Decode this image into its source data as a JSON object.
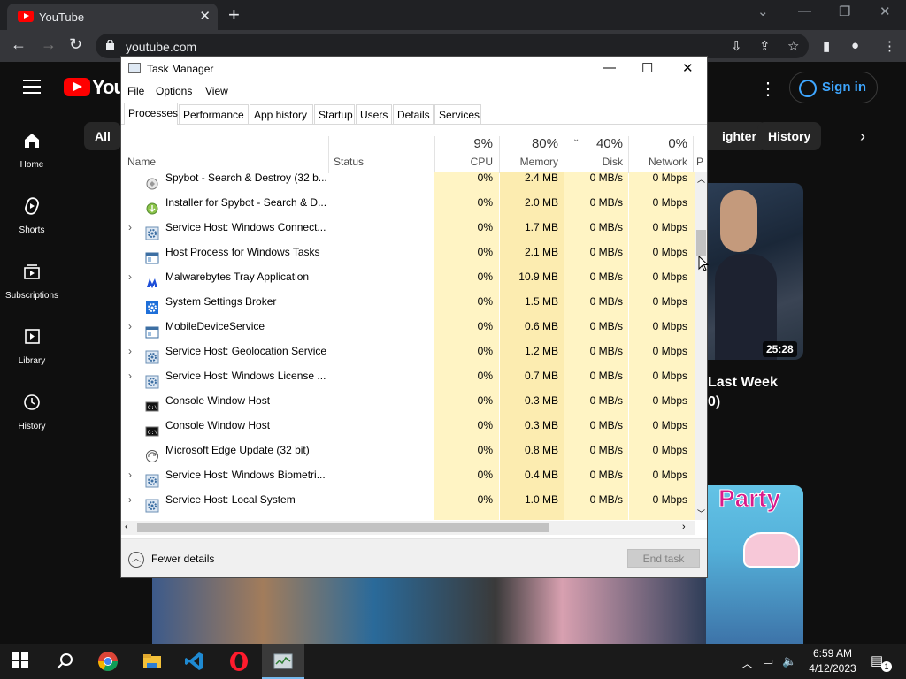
{
  "browser": {
    "tab_title": "YouTube",
    "url": "youtube.com"
  },
  "youtube": {
    "logo_text": "YouT",
    "sidebar": [
      {
        "label": "Home",
        "icon": "home-icon"
      },
      {
        "label": "Shorts",
        "icon": "shorts-icon"
      },
      {
        "label": "Subscriptions",
        "icon": "subscriptions-icon"
      },
      {
        "label": "Library",
        "icon": "library-icon"
      },
      {
        "label": "History",
        "icon": "history-icon"
      }
    ],
    "chips": [
      "All",
      "ighter",
      "History"
    ],
    "sign_in": "Sign in",
    "video1_duration": "25:28",
    "video1_title_line1": "Last Week",
    "video1_title_line2": "0)",
    "video2_overlay": "Party"
  },
  "task_manager": {
    "title": "Task Manager",
    "menu": [
      "File",
      "Options",
      "View"
    ],
    "tabs": [
      "Processes",
      "Performance",
      "App history",
      "Startup",
      "Users",
      "Details",
      "Services"
    ],
    "active_tab": "Processes",
    "columns": {
      "name": "Name",
      "status": "Status",
      "cpu": {
        "pct": "9%",
        "label": "CPU"
      },
      "memory": {
        "pct": "80%",
        "label": "Memory"
      },
      "disk": {
        "pct": "40%",
        "label": "Disk"
      },
      "network": {
        "pct": "0%",
        "label": "Network"
      },
      "power": "P"
    },
    "rows": [
      {
        "name": "Spybot - Search & Destroy (32 b...",
        "expand": false,
        "icon": "spybot-icon",
        "cpu": "0%",
        "memory": "2.4 MB",
        "disk": "0 MB/s",
        "network": "0 Mbps"
      },
      {
        "name": "Installer for Spybot - Search & D...",
        "expand": false,
        "icon": "installer-icon",
        "cpu": "0%",
        "memory": "2.0 MB",
        "disk": "0 MB/s",
        "network": "0 Mbps"
      },
      {
        "name": "Service Host: Windows Connect...",
        "expand": true,
        "icon": "gear-icon",
        "cpu": "0%",
        "memory": "1.7 MB",
        "disk": "0 MB/s",
        "network": "0 Mbps"
      },
      {
        "name": "Host Process for Windows Tasks",
        "expand": false,
        "icon": "window-icon",
        "cpu": "0%",
        "memory": "2.1 MB",
        "disk": "0 MB/s",
        "network": "0 Mbps"
      },
      {
        "name": "Malwarebytes Tray Application",
        "expand": true,
        "icon": "malwarebytes-icon",
        "cpu": "0%",
        "memory": "10.9 MB",
        "disk": "0 MB/s",
        "network": "0 Mbps"
      },
      {
        "name": "System Settings Broker",
        "expand": false,
        "icon": "settings-icon",
        "cpu": "0%",
        "memory": "1.5 MB",
        "disk": "0 MB/s",
        "network": "0 Mbps"
      },
      {
        "name": "MobileDeviceService",
        "expand": true,
        "icon": "window-icon",
        "cpu": "0%",
        "memory": "0.6 MB",
        "disk": "0 MB/s",
        "network": "0 Mbps"
      },
      {
        "name": "Service Host: Geolocation Service",
        "expand": true,
        "icon": "gear-icon",
        "cpu": "0%",
        "memory": "1.2 MB",
        "disk": "0 MB/s",
        "network": "0 Mbps"
      },
      {
        "name": "Service Host: Windows License ...",
        "expand": true,
        "icon": "gear-icon",
        "cpu": "0%",
        "memory": "0.7 MB",
        "disk": "0 MB/s",
        "network": "0 Mbps"
      },
      {
        "name": "Console Window Host",
        "expand": false,
        "icon": "console-icon",
        "cpu": "0%",
        "memory": "0.3 MB",
        "disk": "0 MB/s",
        "network": "0 Mbps"
      },
      {
        "name": "Console Window Host",
        "expand": false,
        "icon": "console-icon",
        "cpu": "0%",
        "memory": "0.3 MB",
        "disk": "0 MB/s",
        "network": "0 Mbps"
      },
      {
        "name": "Microsoft Edge Update (32 bit)",
        "expand": false,
        "icon": "edge-update-icon",
        "cpu": "0%",
        "memory": "0.8 MB",
        "disk": "0 MB/s",
        "network": "0 Mbps"
      },
      {
        "name": "Service Host: Windows Biometri...",
        "expand": true,
        "icon": "gear-icon",
        "cpu": "0%",
        "memory": "0.4 MB",
        "disk": "0 MB/s",
        "network": "0 Mbps"
      },
      {
        "name": "Service Host: Local System",
        "expand": true,
        "icon": "gear-icon",
        "cpu": "0%",
        "memory": "1.0 MB",
        "disk": "0 MB/s",
        "network": "0 Mbps"
      }
    ],
    "fewer_details": "Fewer details",
    "end_task": "End task"
  },
  "taskbar": {
    "time": "6:59 AM",
    "date": "4/12/2023",
    "notification_count": "1"
  },
  "colors": {
    "heat_cell": "#fff4c4",
    "youtube_red": "#ff0000",
    "link_blue": "#3ea6ff"
  }
}
